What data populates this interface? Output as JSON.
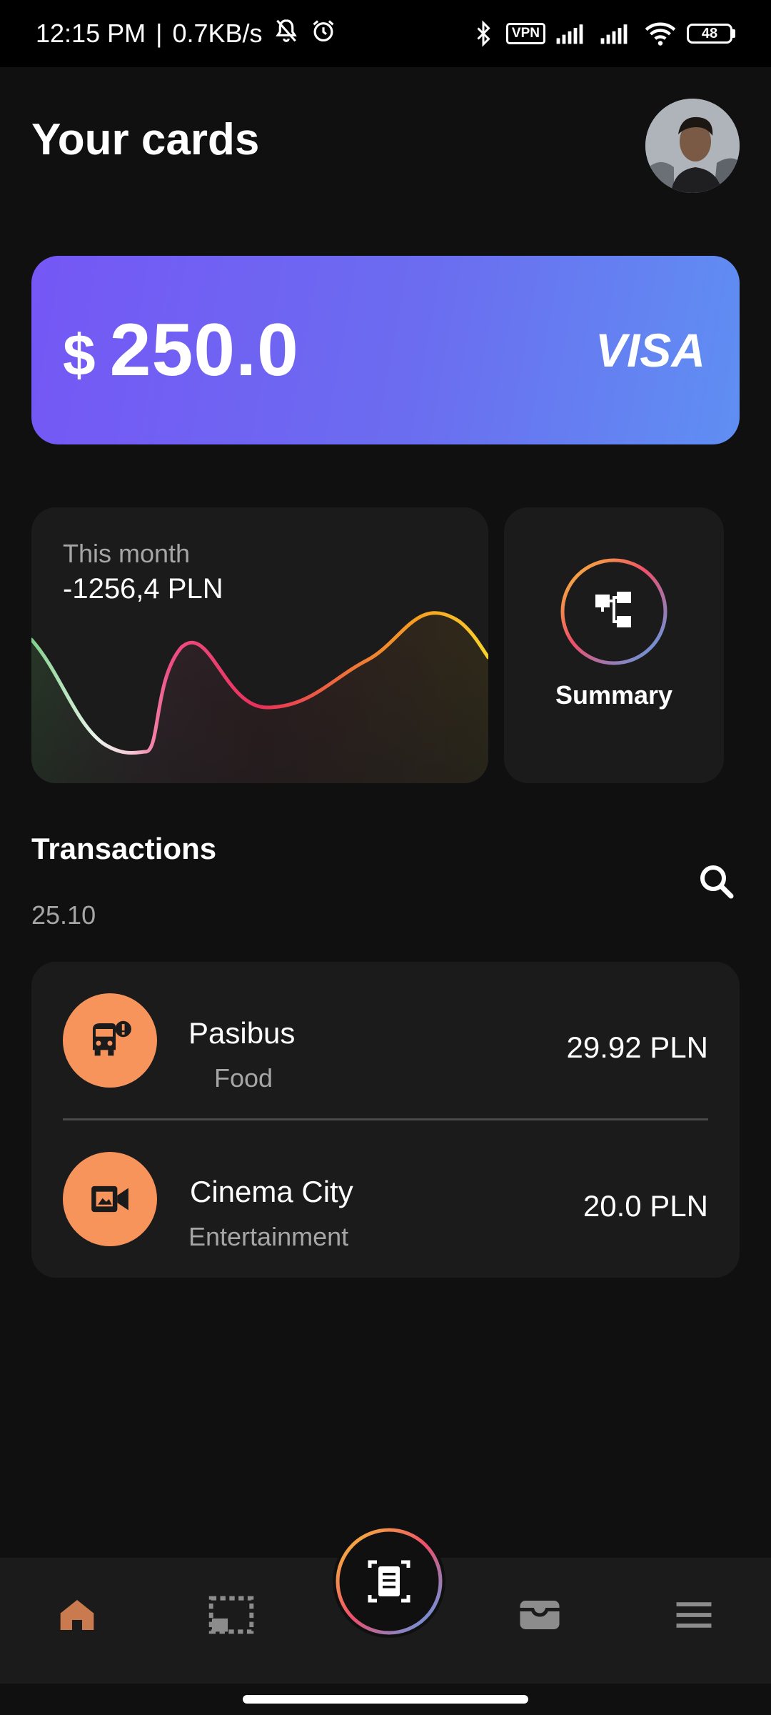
{
  "status_bar": {
    "time": "12:15 PM",
    "speed": "0.7KB/s",
    "separator": "|",
    "vpn": "VPN",
    "battery": "48",
    "icons": [
      "bell-muted-icon",
      "alarm-icon",
      "bluetooth-icon",
      "signal-icon",
      "signal-icon",
      "wifi-icon",
      "battery-icon"
    ]
  },
  "header": {
    "title": "Your cards",
    "avatar_icon": "avatar-photo"
  },
  "card": {
    "currency": "$",
    "balance": "250.0",
    "brand": "VISA",
    "colors": {
      "start": "#7557f5",
      "end": "#5f8ff2"
    }
  },
  "month": {
    "label": "This month",
    "amount": "-1256,4 PLN"
  },
  "summary": {
    "label": "Summary",
    "icon": "hierarchy-icon"
  },
  "transactions": {
    "title": "Transactions",
    "date": "25.10",
    "search_icon": "search-icon",
    "items": [
      {
        "name": "Pasibus",
        "category": "Food",
        "amount": "29.92 PLN",
        "icon": "bus-alert-icon"
      },
      {
        "name": "Cinema City",
        "category": "Entertainment",
        "amount": "20.0 PLN",
        "icon": "video-camera-icon"
      }
    ],
    "accent": "#f7945b"
  },
  "nav": {
    "items": [
      {
        "icon": "home-icon",
        "active": true
      },
      {
        "icon": "picture-in-picture-icon",
        "active": false
      },
      {
        "icon": "scan-document-icon",
        "active": false
      },
      {
        "icon": "wallet-icon",
        "active": false
      },
      {
        "icon": "menu-icon",
        "active": false
      }
    ],
    "active_color": "#c97a4f"
  }
}
